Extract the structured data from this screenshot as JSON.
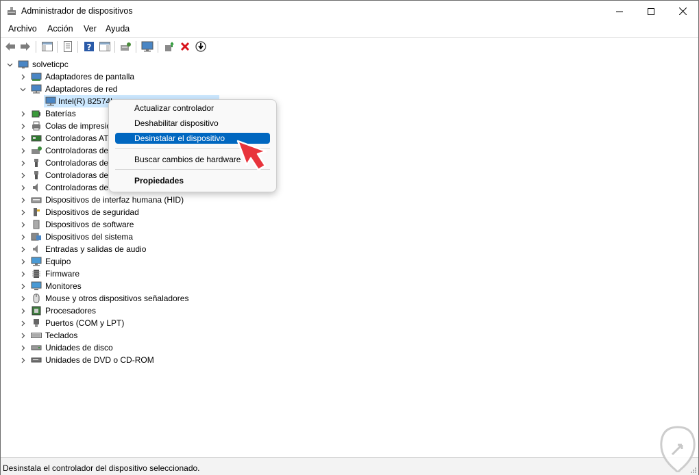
{
  "window": {
    "title": "Administrador de dispositivos"
  },
  "menubar": {
    "items": [
      "Archivo",
      "Acción",
      "Ver",
      "Ayuda"
    ]
  },
  "tree": {
    "root": "solveticpc",
    "items": [
      {
        "label": "Adaptadores de pantalla",
        "icon": "display-adapter-icon",
        "expanded": false
      },
      {
        "label": "Adaptadores de red",
        "icon": "network-adapter-icon",
        "expanded": true
      },
      {
        "label": "Intel(R) 82574L",
        "icon": "network-adapter-icon",
        "child": true
      },
      {
        "label": "Baterías",
        "icon": "battery-icon",
        "expanded": false
      },
      {
        "label": "Colas de impresión",
        "icon": "printer-icon",
        "expanded": false
      },
      {
        "label": "Controladoras ATA",
        "icon": "storage-controller-icon",
        "expanded": false
      },
      {
        "label": "Controladoras de",
        "icon": "storage-controller-icon",
        "expanded": false
      },
      {
        "label": "Controladoras de",
        "icon": "usb-icon",
        "expanded": false
      },
      {
        "label": "Controladoras de",
        "icon": "usb-icon",
        "expanded": false
      },
      {
        "label": "Controladoras de",
        "icon": "audio-icon",
        "expanded": false
      },
      {
        "label": "Dispositivos de interfaz humana (HID)",
        "icon": "hid-icon",
        "expanded": false
      },
      {
        "label": "Dispositivos de seguridad",
        "icon": "security-key-icon",
        "expanded": false
      },
      {
        "label": "Dispositivos de software",
        "icon": "software-device-icon",
        "expanded": false
      },
      {
        "label": "Dispositivos del sistema",
        "icon": "system-device-icon",
        "expanded": false
      },
      {
        "label": "Entradas y salidas de audio",
        "icon": "audio-io-icon",
        "expanded": false
      },
      {
        "label": "Equipo",
        "icon": "computer-icon",
        "expanded": false
      },
      {
        "label": "Firmware",
        "icon": "firmware-icon",
        "expanded": false
      },
      {
        "label": "Monitores",
        "icon": "monitor-icon",
        "expanded": false
      },
      {
        "label": "Mouse y otros dispositivos señaladores",
        "icon": "mouse-icon",
        "expanded": false
      },
      {
        "label": "Procesadores",
        "icon": "processor-icon",
        "expanded": false
      },
      {
        "label": "Puertos (COM y LPT)",
        "icon": "port-icon",
        "expanded": false
      },
      {
        "label": "Teclados",
        "icon": "keyboard-icon",
        "expanded": false
      },
      {
        "label": "Unidades de disco",
        "icon": "disk-drive-icon",
        "expanded": false
      },
      {
        "label": "Unidades de DVD o CD-ROM",
        "icon": "dvd-drive-icon",
        "expanded": false
      }
    ]
  },
  "context_menu": {
    "items": [
      "Actualizar controlador",
      "Deshabilitar dispositivo",
      "Desinstalar el dispositivo",
      "Buscar cambios de hardware",
      "Propiedades"
    ],
    "highlighted": "Desinstalar el dispositivo"
  },
  "statusbar": {
    "text": "Desinstala el controlador del dispositivo seleccionado."
  },
  "colors": {
    "accent": "#0067c0",
    "selection": "#cce8ff",
    "pointer": "#e8343c"
  }
}
